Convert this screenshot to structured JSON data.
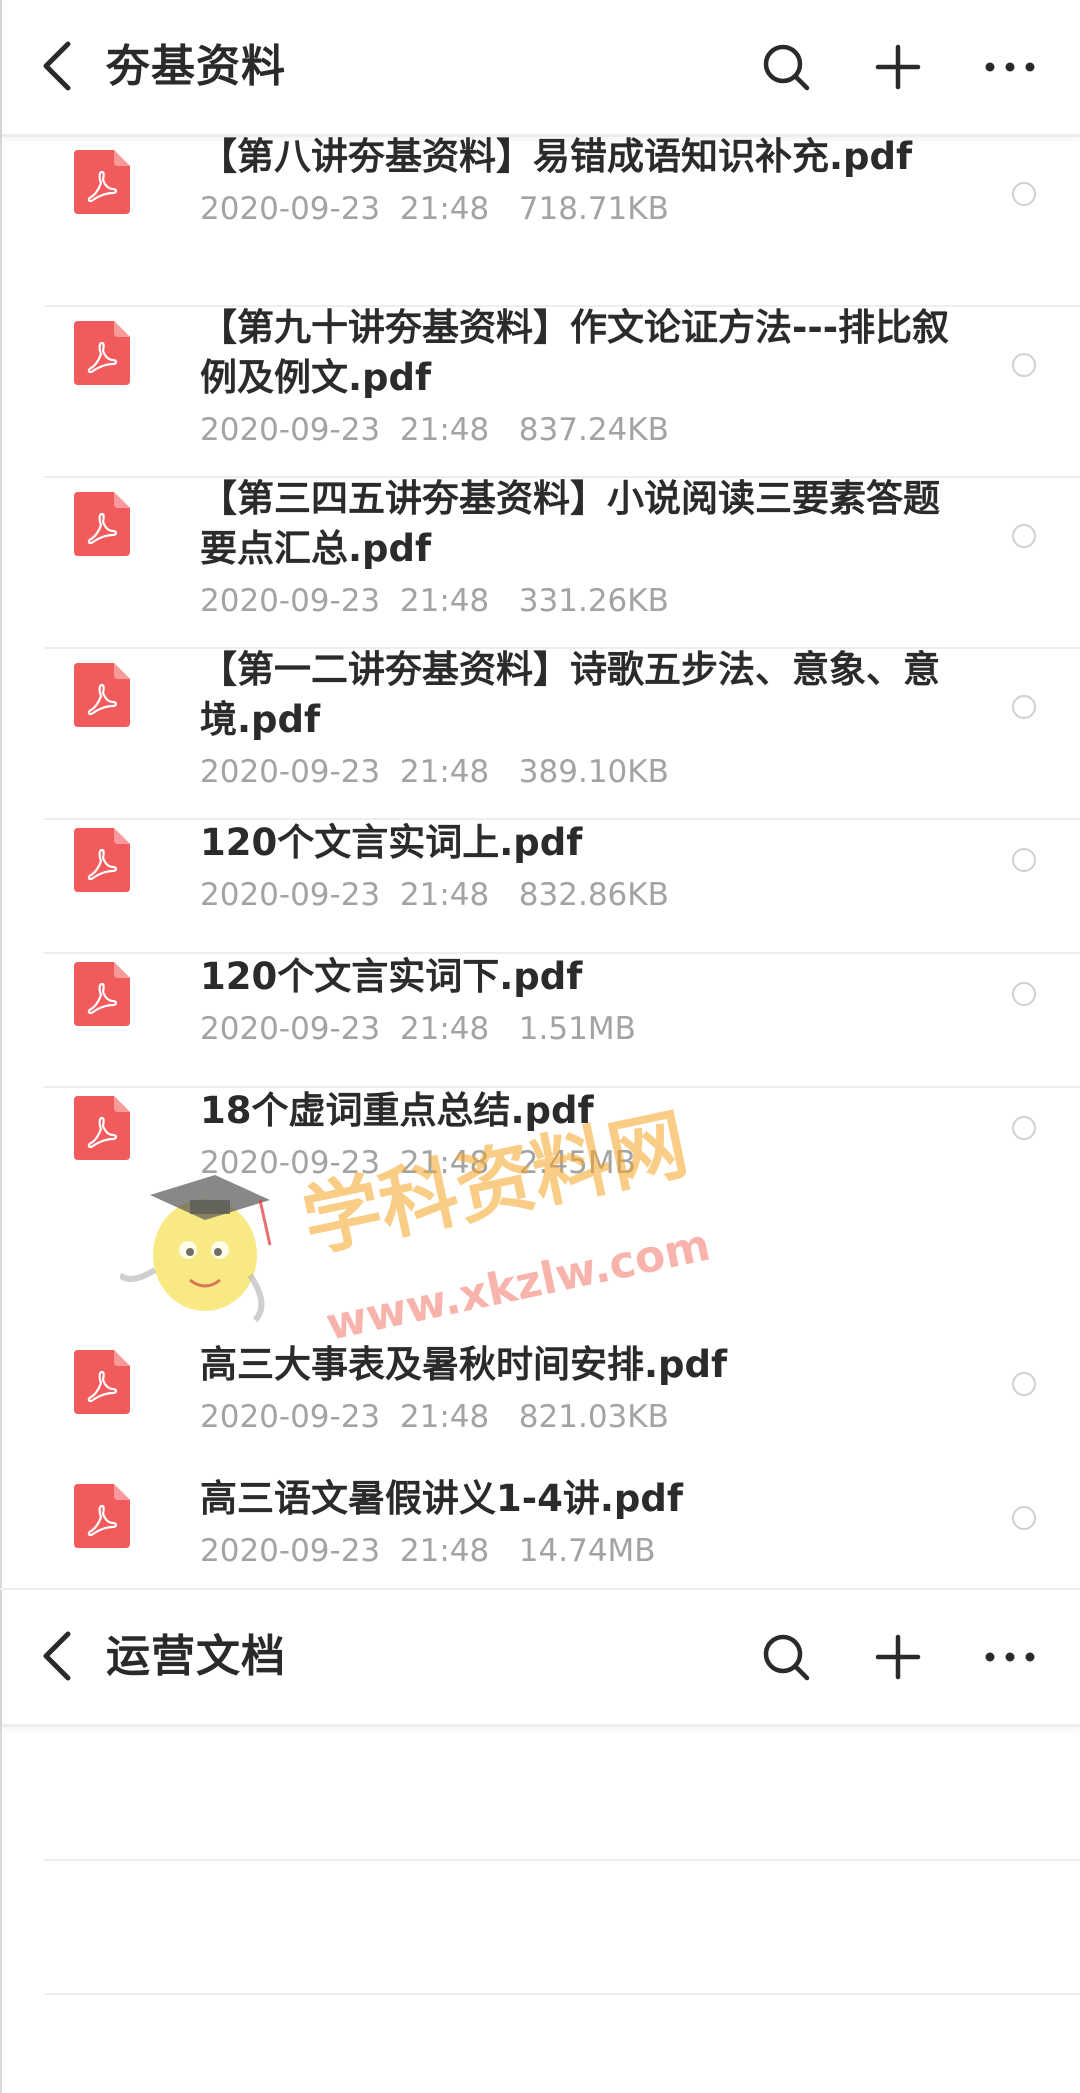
{
  "colors": {
    "pdf_icon": "#f25b5b",
    "text_primary": "#2b2b2b",
    "text_secondary": "#a3a3a3",
    "divider": "#eeeeee",
    "watermark_orange": "#f5a623",
    "watermark_green": "#7ed321",
    "watermark_blue": "#4a90e2",
    "watermark_red": "#f26b5b"
  },
  "icons": {
    "back": "chevron-left-icon",
    "search": "search-icon",
    "add": "plus-icon",
    "more": "more-horizontal-icon",
    "file": "pdf-file-icon",
    "select": "radio-circle-icon"
  },
  "screens": [
    {
      "header": {
        "title": "夯基资料"
      },
      "files": [
        {
          "name": "【第八讲夯基资料】易错成语知识补充.pdf",
          "date": "2020-09-23",
          "time": "21:48",
          "size": "718.71KB"
        },
        {
          "name": "【第九十讲夯基资料】作文论证方法---排比叙例及例文.pdf",
          "date": "2020-09-23",
          "time": "21:48",
          "size": "837.24KB"
        },
        {
          "name": "【第三四五讲夯基资料】小说阅读三要素答题要点汇总.pdf",
          "date": "2020-09-23",
          "time": "21:48",
          "size": "331.26KB"
        },
        {
          "name": "【第一二讲夯基资料】诗歌五步法、意象、意境.pdf",
          "date": "2020-09-23",
          "time": "21:48",
          "size": "389.10KB"
        },
        {
          "name": "120个文言实词上.pdf",
          "date": "2020-09-23",
          "time": "21:48",
          "size": "832.86KB"
        },
        {
          "name": "120个文言实词下.pdf",
          "date": "2020-09-23",
          "time": "21:48",
          "size": "1.51MB"
        },
        {
          "name": "18个虚词重点总结.pdf",
          "date": "2020-09-23",
          "time": "21:48",
          "size": "2.45MB"
        }
      ]
    },
    {
      "header": {
        "title": "运营文档"
      },
      "files": [
        {
          "name": "高三大事表及暑秋时间安排.pdf",
          "date": "2020-09-23",
          "time": "21:48",
          "size": "821.03KB"
        },
        {
          "name": "高三语文暑假讲义1-4讲.pdf",
          "date": "2020-09-23",
          "time": "21:48",
          "size": "14.74MB"
        }
      ]
    }
  ],
  "watermark": {
    "title": "学科资料网",
    "url": "www.xkzlw.com"
  }
}
